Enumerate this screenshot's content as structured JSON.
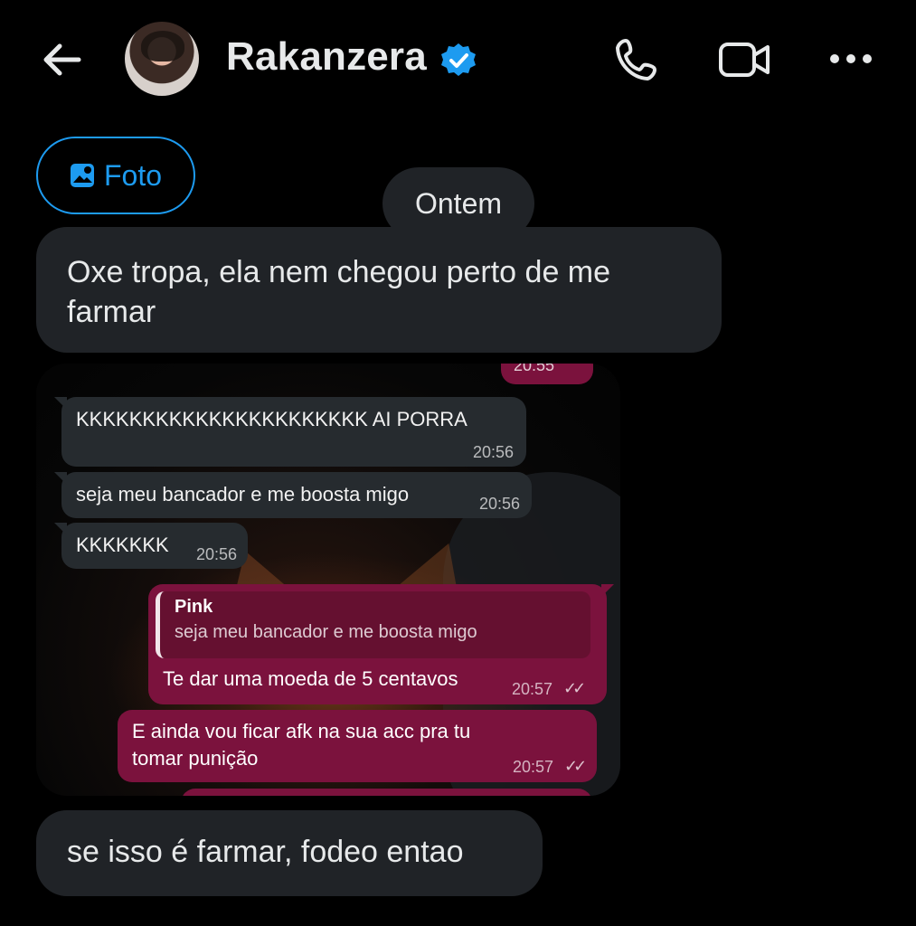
{
  "header": {
    "title": "Rakanzera",
    "icons": {
      "back": "arrow-left-icon",
      "verified": "verified-badge-icon",
      "call": "phone-icon",
      "video": "video-icon",
      "more": "more-icon"
    },
    "colors": {
      "verified": "#1d9bf0",
      "text": "#e7e9ea"
    }
  },
  "chat": {
    "foto_label": "Foto",
    "date_chip": "Ontem",
    "messages": [
      {
        "text": "Oxe tropa, ela nem chegou perto de me farmar"
      },
      {
        "text": "se isso é farmar, fodeo entao"
      }
    ]
  },
  "embedded_screenshot": {
    "partial_top_time": "20:55",
    "messages": [
      {
        "text": "KKKKKKKKKKKKKKKKKKKKKK AI PORRA",
        "time": "20:56"
      },
      {
        "text": "seja meu bancador e me boosta migo",
        "time": "20:56"
      },
      {
        "text": "KKKKKKK",
        "time": "20:56"
      },
      {
        "quote_name": "Pink",
        "quote_text": "seja meu bancador e me boosta migo",
        "text": "Te dar uma moeda de 5 centavos",
        "time": "20:57"
      },
      {
        "line1": "E ainda vou ficar afk na sua acc pra tu",
        "line2": "tomar punição",
        "time": "20:57"
      }
    ],
    "colors": {
      "incoming": "#262b2f",
      "outgoing": "#7b123d"
    }
  }
}
